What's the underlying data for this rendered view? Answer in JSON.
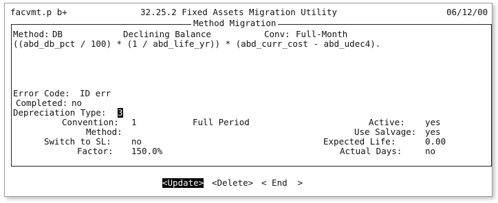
{
  "header": {
    "program": "facvmt.p b+",
    "title": "32.25.2 Fixed Assets Migration Utility",
    "date": "06/12/00"
  },
  "frame": {
    "legend": "Method Migration"
  },
  "method": {
    "method_label": "Method:",
    "method_code": "DB",
    "method_desc": "Declining Balance",
    "conv_label": "Conv:",
    "conv_value": "Full-Month",
    "formula": "((abd_db_pct / 100) * (1 / abd_life_yr)) * (abd_curr_cost - abd_udec4)."
  },
  "status": {
    "error_label": "Error Code:",
    "error_value": "ID err",
    "completed_label": "Completed:",
    "completed_value": "no"
  },
  "form": {
    "dep_type_label": "Depreciation Type:",
    "dep_type_value": "3",
    "convention_label": "Convention:",
    "convention_value": "1",
    "convention_desc": "Full Period",
    "method_label": "Method:",
    "method_value": "",
    "switch_label": "Switch to SL:",
    "switch_value": "no",
    "factor_label": "Factor:",
    "factor_value": "150.0%",
    "active_label": "Active:",
    "active_value": "yes",
    "salvage_label": "Use Salvage:",
    "salvage_value": "yes",
    "life_label": "Expected Life:",
    "life_value": "0.00",
    "days_label": "Actual Days:",
    "days_value": "no"
  },
  "actions": {
    "update": "<Update>",
    "delete": "<Delete>",
    "end": "< End  >"
  }
}
